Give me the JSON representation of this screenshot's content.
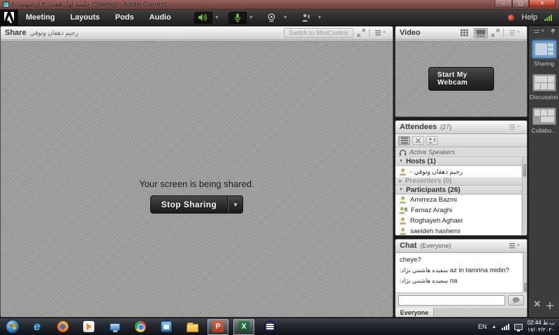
{
  "window": {
    "title": "جلسه اول هفته(۳۰ ارديبهشت) (Sharing) - Adobe Connect"
  },
  "menubar": {
    "items": [
      "Meeting",
      "Layouts",
      "Pods",
      "Audio"
    ],
    "help_label": "Help"
  },
  "share_pod": {
    "title": "Share",
    "presenter": "رحيم دهقان وثوقي",
    "switch_button": "Switch to MiniControl",
    "status_text": "Your screen is being shared.",
    "stop_button": "Stop Sharing"
  },
  "video_pod": {
    "title": "Video",
    "start_webcam_button": "Start My Webcam"
  },
  "attendees_pod": {
    "title": "Attendees",
    "count": "(27)",
    "active_speakers_label": "Active Speakers",
    "hosts_label": "Hosts (1)",
    "host_name": "رحيم دهقان وثوقي -",
    "presenters_label": "Presenters (0)",
    "participants_label": "Participants (26)",
    "participants": [
      "Amirreza Bazmi",
      "Farnaz Araghi",
      "Roghayeh Aghaei",
      "saeideh hashemi"
    ]
  },
  "chat_pod": {
    "title": "Chat",
    "scope": "(Everyone)",
    "messages": [
      {
        "sender": "",
        "text": "cheye?"
      },
      {
        "sender": "سعيده هاشمي نژاد:",
        "text": "az in tamrina  midin?"
      },
      {
        "sender": "سعيده هاشمي نژاد:",
        "text": "na"
      }
    ],
    "input_value": "",
    "tab_label": "Everyone"
  },
  "layout_bar": {
    "items": [
      "Sharing",
      "Discussion",
      "Collabo..."
    ],
    "active_item": "Sharing"
  },
  "taskbar": {
    "icons": [
      "start",
      "internet-explorer",
      "firefox",
      "windows-media-player",
      "remote-desktop",
      "chrome",
      "app-window",
      "file-explorer",
      "powerpoint",
      "excel",
      "eclipse"
    ],
    "active_icons": [
      "powerpoint",
      "excel"
    ],
    "tray": {
      "language": "EN",
      "time": "02:44 ب.ظ",
      "date": "۱۷/۰۲/۲۰۲۰"
    }
  },
  "colors": {
    "accent_green": "#76b043",
    "record_red": "#c23a28",
    "selection_blue": "#5b97d8",
    "titlebar": "#7b4a46",
    "menubar": "#2a2a2a"
  }
}
